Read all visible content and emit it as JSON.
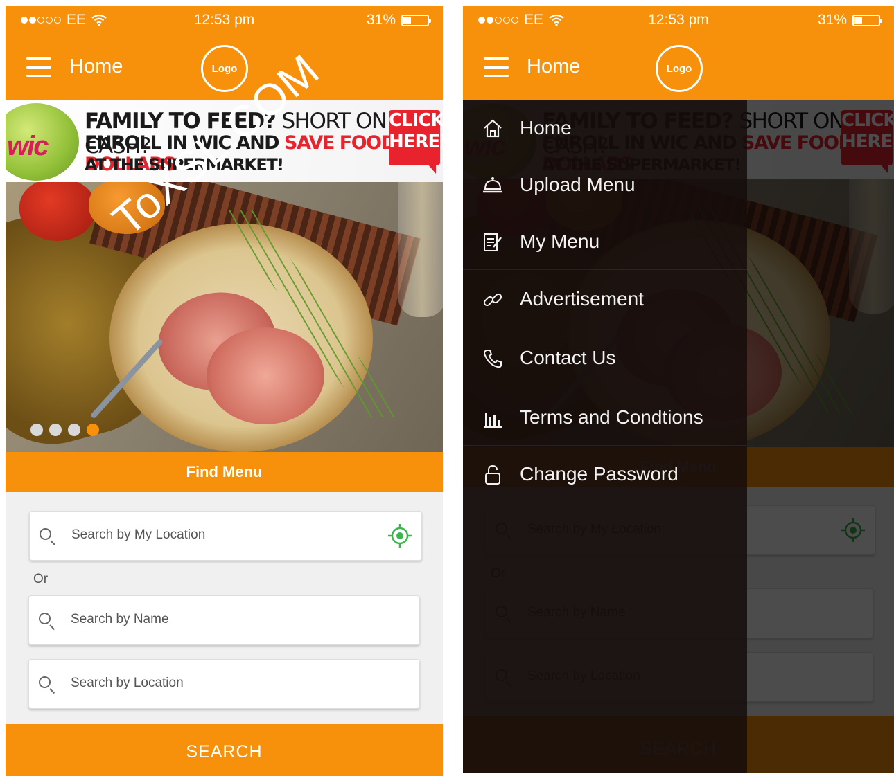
{
  "status_bar": {
    "carrier": "EE",
    "time": "12:53 pm",
    "battery": "31%",
    "battery_level": 0.31
  },
  "header": {
    "title": "Home",
    "logo_text": "Logo"
  },
  "banner": {
    "line1_a": "FAMILY TO FEED?",
    "line1_b": "SHORT ON CASH?",
    "line2_a": "ENROLL IN WIC AND",
    "line2_b": "SAVE FOOD DOLLARS",
    "line3": "AT THE SUPERMARKET!",
    "badge_top": "CLICK",
    "badge_bottom": "HERE!",
    "logo_text": "wic"
  },
  "carousel": {
    "active_index": 3,
    "count": 4,
    "watermark": "ToXSL.COM"
  },
  "find_menu": {
    "label": "Find Menu"
  },
  "search": {
    "my_location_placeholder": "Search by My Location",
    "or_text": "Or",
    "name_placeholder": "Search by Name",
    "location_placeholder": "Search by Location",
    "button_label": "SEARCH"
  },
  "drawer": {
    "items": [
      {
        "label": "Home",
        "icon": "home-icon"
      },
      {
        "label": "Upload Menu",
        "icon": "cloche-icon"
      },
      {
        "label": "My Menu",
        "icon": "edit-list-icon"
      },
      {
        "label": "Advertisement",
        "icon": "link-icon"
      },
      {
        "label": "Contact Us",
        "icon": "phone-icon"
      },
      {
        "label": "Terms and Condtions",
        "icon": "bar-chart-icon"
      },
      {
        "label": "Change Password",
        "icon": "lock-icon"
      }
    ]
  },
  "colors": {
    "accent": "#f7900a",
    "target_green": "#3fb34f",
    "badge_red": "#e8232e"
  }
}
